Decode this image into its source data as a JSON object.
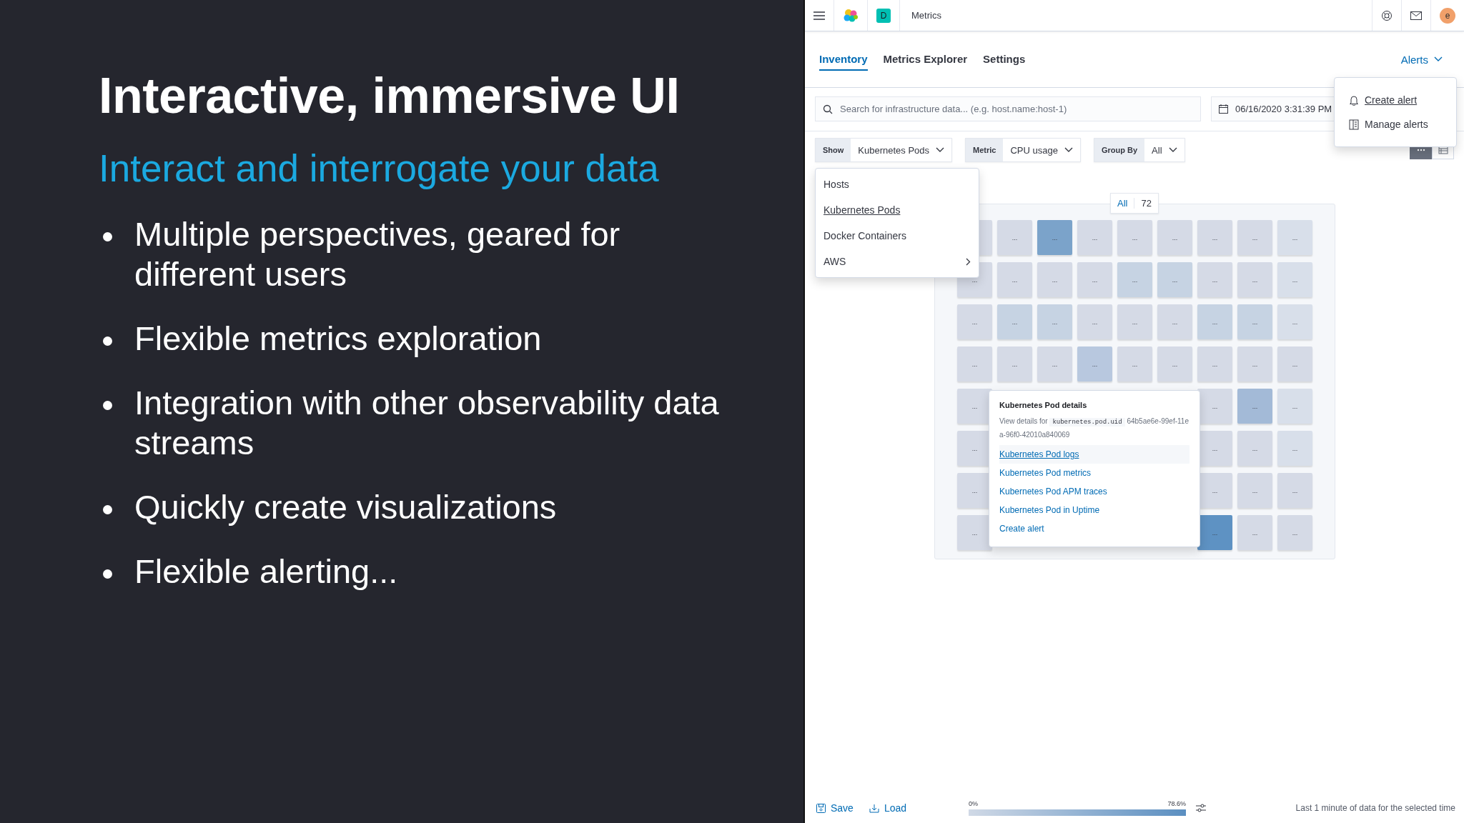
{
  "slide": {
    "title": "Interactive, immersive UI",
    "subtitle": "Interact and interrogate your data",
    "bullets": [
      {
        "lines": [
          "Multiple perspectives, geared for",
          "different users"
        ]
      },
      {
        "lines": [
          "Flexible metrics exploration"
        ]
      },
      {
        "lines": [
          "Integration with other observability data",
          "streams"
        ]
      },
      {
        "lines": [
          "Quickly create visualizations"
        ]
      },
      {
        "lines": [
          "Flexible alerting..."
        ]
      }
    ]
  },
  "app": {
    "header": {
      "space_badge": "D",
      "title": "Metrics",
      "avatar": "e"
    },
    "tabs": [
      {
        "label": "Inventory",
        "selected": true
      },
      {
        "label": "Metrics Explorer",
        "selected": false
      },
      {
        "label": "Settings",
        "selected": false
      }
    ],
    "alerts_button": {
      "label": "Alerts"
    },
    "alerts_menu": [
      {
        "label": "Create alert",
        "kind": "bell",
        "highlighted": true
      },
      {
        "label": "Manage alerts",
        "kind": "list",
        "highlighted": false
      }
    ],
    "search": {
      "placeholder": "Search for infrastructure data... (e.g. host.name:host-1)"
    },
    "date_picker": {
      "value": "06/16/2020 3:31:39 PM"
    },
    "filters": [
      {
        "label": "Show",
        "value": "Kubernetes Pods"
      },
      {
        "label": "Metric",
        "value": "CPU usage"
      },
      {
        "label": "Group By",
        "value": "All"
      }
    ],
    "view_toggle": [
      {
        "kind": "map",
        "selected": true
      },
      {
        "kind": "table",
        "selected": false
      }
    ],
    "show_menu": [
      {
        "label": "Hosts",
        "selected": false,
        "submenu": false
      },
      {
        "label": "Kubernetes Pods",
        "selected": true,
        "submenu": false
      },
      {
        "label": "Docker Containers",
        "selected": false,
        "submenu": false
      },
      {
        "label": "AWS",
        "selected": false,
        "submenu": true
      }
    ],
    "counter": {
      "label": "All",
      "value": "72"
    },
    "tiles": [
      [
        {
          "color": "#d5dae6"
        },
        {
          "label": "...",
          "color": "#d5dae6"
        },
        {
          "label": "...",
          "color": "#7ba3ca"
        },
        {
          "label": "...",
          "color": "#d5dae6"
        },
        {
          "label": "...",
          "color": "#d5dae6"
        },
        {
          "label": "...",
          "color": "#d5dae6"
        },
        {
          "label": "...",
          "color": "#d5dae6"
        },
        {
          "label": "...",
          "color": "#d5dae6"
        },
        {
          "label": "...",
          "color": "#d8dfea"
        }
      ],
      [
        {
          "label": "...",
          "color": "#d5dae6"
        },
        {
          "label": "...",
          "color": "#d5dae6"
        },
        {
          "label": "...",
          "color": "#d5dae6"
        },
        {
          "label": "...",
          "color": "#d5dae6"
        },
        {
          "label": "...",
          "color": "#c6d3e3"
        },
        {
          "label": "...",
          "color": "#c6d3e3"
        },
        {
          "label": "...",
          "color": "#d5dae6"
        },
        {
          "label": "...",
          "color": "#d5dae6"
        },
        {
          "label": "...",
          "color": "#d8dfea"
        }
      ],
      [
        {
          "label": "...",
          "color": "#d5dae6"
        },
        {
          "label": "...",
          "color": "#c6d3e3"
        },
        {
          "label": "...",
          "color": "#c6d3e3"
        },
        {
          "label": "...",
          "color": "#d5dae6"
        },
        {
          "label": "...",
          "color": "#d5dae6"
        },
        {
          "label": "...",
          "color": "#d5dae6"
        },
        {
          "label": "...",
          "color": "#c6d3e3"
        },
        {
          "label": "...",
          "color": "#c6d3e3"
        },
        {
          "label": "...",
          "color": "#d8dfea"
        }
      ],
      [
        {
          "label": "...",
          "color": "#d5dae6"
        },
        {
          "label": "...",
          "color": "#d5dae6"
        },
        {
          "label": "...",
          "color": "#d5dae6"
        },
        {
          "label": "...",
          "color": "#b8c8df"
        },
        {
          "label": "...",
          "color": "#d5dae6"
        },
        {
          "label": "...",
          "color": "#d5dae6"
        },
        {
          "label": "...",
          "color": "#d5dae6"
        },
        {
          "label": "...",
          "color": "#d5dae6"
        },
        {
          "label": "...",
          "color": "#d5dae6"
        }
      ],
      [
        {
          "label": "...",
          "color": "#d5dae6"
        },
        {
          "label": "...",
          "color": "#d5dae6"
        },
        {
          "label": "...",
          "color": "#a3bad7"
        },
        {
          "label": "...",
          "color": "#d8dfea"
        }
      ],
      [
        {
          "label": "...",
          "color": "#d5dae6"
        },
        {
          "label": "...",
          "color": "#d5dae6"
        },
        {
          "label": "...",
          "color": "#d5dae6"
        },
        {
          "label": "...",
          "color": "#d8dfea"
        }
      ],
      [
        {
          "label": "...",
          "color": "#d5dae6"
        },
        {
          "label": "...",
          "color": "#d5dae6"
        },
        {
          "label": "...",
          "color": "#d5dae6"
        },
        {
          "label": "...",
          "color": "#d5dae6"
        }
      ],
      [
        {
          "label": "...",
          "color": "#d5dae6"
        },
        {
          "label": "...",
          "color": "#5e92c3"
        },
        {
          "label": "...",
          "color": "#d5dae6"
        },
        {
          "label": "...",
          "color": "#d5dae6"
        }
      ]
    ],
    "tooltip": {
      "title": "Kubernetes Pod details",
      "prefix": "View details for",
      "field": "kubernetes.pod.uid",
      "value": "64b5ae6e-99ef-11ea-96f0-42010a840069",
      "links": [
        {
          "label": "Kubernetes Pod logs",
          "highlighted": true
        },
        {
          "label": "Kubernetes Pod metrics",
          "highlighted": false
        },
        {
          "label": "Kubernetes Pod APM traces",
          "highlighted": false
        },
        {
          "label": "Kubernetes Pod in Uptime",
          "highlighted": false
        },
        {
          "label": "Create alert",
          "highlighted": false
        }
      ]
    },
    "footer": {
      "save": "Save",
      "load": "Load",
      "legend_min": "0%",
      "legend_max": "78.6%",
      "status": "Last 1 minute of data for the selected time"
    }
  }
}
